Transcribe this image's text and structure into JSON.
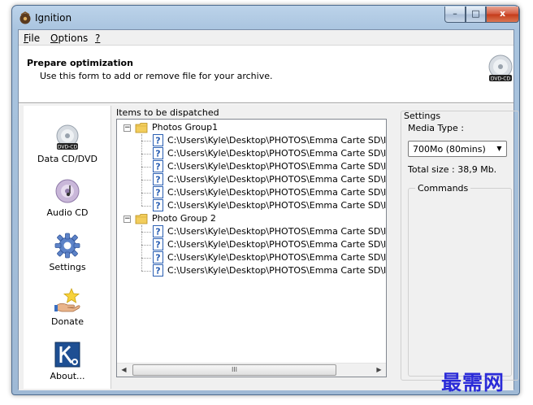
{
  "window": {
    "title": "Ignition",
    "buttons": {
      "minimize": "–",
      "maximize": "□",
      "close": "x"
    }
  },
  "menu": [
    {
      "label": "File",
      "ul": "F",
      "rest": "ile"
    },
    {
      "label": "Options",
      "ul": "O",
      "rest": "ptions"
    },
    {
      "label": "?",
      "ul": "?",
      "rest": ""
    }
  ],
  "header": {
    "title": "Prepare optimization",
    "subtitle": "Use this form to add or remove file for your archive.",
    "icon": "dvd-cd-icon",
    "icon_text": "DVD-CD"
  },
  "sidebar": {
    "items": [
      {
        "label": "Data CD/DVD",
        "icon": "dvd-cd-icon",
        "badge": "DVD-CD"
      },
      {
        "label": "Audio CD",
        "icon": "audio-cd-icon"
      },
      {
        "label": "Settings",
        "icon": "gear-icon"
      },
      {
        "label": "Donate",
        "icon": "donate-hand-icon"
      },
      {
        "label": "About...",
        "icon": "about-k-icon"
      }
    ]
  },
  "items": {
    "label": "Items to be dispatched",
    "groups": [
      {
        "name": "Photos Group1",
        "files": [
          "C:\\Users\\Kyle\\Desktop\\PHOTOS\\Emma Carte SD\\IMG_",
          "C:\\Users\\Kyle\\Desktop\\PHOTOS\\Emma Carte SD\\IMG_",
          "C:\\Users\\Kyle\\Desktop\\PHOTOS\\Emma Carte SD\\IMG_",
          "C:\\Users\\Kyle\\Desktop\\PHOTOS\\Emma Carte SD\\IMG_",
          "C:\\Users\\Kyle\\Desktop\\PHOTOS\\Emma Carte SD\\IMG_",
          "C:\\Users\\Kyle\\Desktop\\PHOTOS\\Emma Carte SD\\IMG_"
        ]
      },
      {
        "name": "Photo Group 2",
        "files": [
          "C:\\Users\\Kyle\\Desktop\\PHOTOS\\Emma Carte SD\\IMG_",
          "C:\\Users\\Kyle\\Desktop\\PHOTOS\\Emma Carte SD\\IMG_",
          "C:\\Users\\Kyle\\Desktop\\PHOTOS\\Emma Carte SD\\IMG_",
          "C:\\Users\\Kyle\\Desktop\\PHOTOS\\Emma Carte SD\\IMG_"
        ]
      }
    ],
    "scroll_thumb": "III"
  },
  "settings": {
    "label": "Settings",
    "media_type_label": "Media Type :",
    "media_type_value": "700Mo (80mins)",
    "total_size": "Total size : 38,9 Mb.",
    "commands_label": "Commands"
  },
  "watermark": "最需网",
  "colors": {
    "frame": "#a9c4df",
    "close_button": "#c43a18",
    "folder": "#f2cd5c",
    "file_icon": "#2a5fb3",
    "watermark": "#2b2bd8"
  }
}
